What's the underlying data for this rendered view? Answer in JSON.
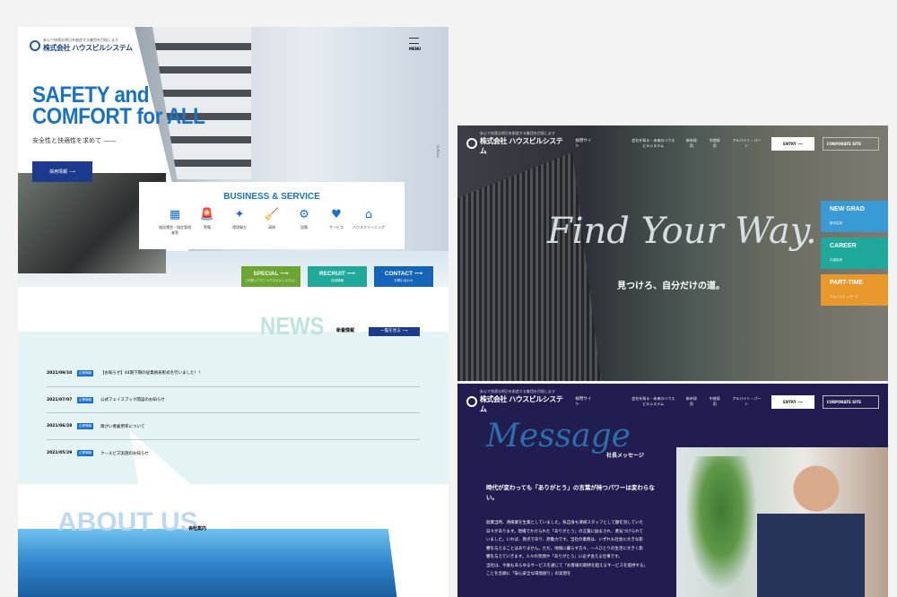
{
  "corporate_site": {
    "logo": {
      "tagline": "安心で快適な明日を創造する集団を目指します",
      "name": "株式会社 ハウスビルシステム"
    },
    "menu_label": "MENU",
    "hero": {
      "title_line1": "SAFETY and",
      "title_line2": "COMFORT for ALL",
      "subtitle": "安全性と快適性を求めて ——",
      "recruit_button": "採用情報 ⟶",
      "scroll_label": "SCROLL"
    },
    "business": {
      "title": "BUSINESS & SERVICE",
      "items": [
        {
          "icon": "building-icon",
          "glyph": "▦",
          "label": "施設運営・指定管理者等"
        },
        {
          "icon": "alarm-light-icon",
          "glyph": "🚨",
          "label": "警備"
        },
        {
          "icon": "sparkle-icon",
          "glyph": "✦",
          "label": "環境衛生"
        },
        {
          "icon": "broom-icon",
          "glyph": "🧹",
          "label": "清掃"
        },
        {
          "icon": "gear-icon",
          "glyph": "⚙",
          "label": "設備"
        },
        {
          "icon": "heart-hand-icon",
          "glyph": "♥",
          "label": "サービス"
        },
        {
          "icon": "house-icon",
          "glyph": "⌂",
          "label": "ハウスクリーニング"
        }
      ]
    },
    "cta": [
      {
        "title": "SPECIAL ⟶",
        "sub": "これ知ってた？ハウスビルシステム！",
        "color": "#6aa631"
      },
      {
        "title": "RECRUIT ⟶",
        "sub": "採用情報",
        "color": "#1ea99a"
      },
      {
        "title": "CONTACT ⟶",
        "sub": "お問い合わせ",
        "color": "#1464b8"
      }
    ],
    "news": {
      "title": "NEWS",
      "subtitle": "新着情報",
      "all_button": "一覧を見る ⟶",
      "items": [
        {
          "date": "2021/09/10",
          "category": "企業情報",
          "text": "【お知らせ】44期下期の従業員表彰式を行いました！！"
        },
        {
          "date": "2021/07/07",
          "category": "企業情報",
          "text": "公式フェイスブック開設のお知らせ"
        },
        {
          "date": "2021/06/28",
          "category": "企業情報",
          "text": "障がい者雇用率について"
        },
        {
          "date": "2021/05/29",
          "category": "企業情報",
          "text": "クールビズ実施のお知らせ"
        }
      ]
    },
    "about": {
      "title": "ABOUT US",
      "subtitle": "会社案内"
    }
  },
  "recruit_site": {
    "header": {
      "site_label": "採用サイト",
      "nav": [
        "会社を知る・未来のハウスビルシステム",
        "新卒採用",
        "中途採用",
        "アルバイト・パート"
      ],
      "entry": "ENTRY ⟶",
      "corporate": "CORPORATE SITE"
    },
    "hero": {
      "headline": "Find Your Way.",
      "sub": "見つけろ、自分だけの道。"
    },
    "side_buttons": [
      {
        "title": "NEW GRAD",
        "sub": "新卒採用",
        "color": "#3a9ad6"
      },
      {
        "title": "CAREER",
        "sub": "中途採用",
        "color": "#1ea99a"
      },
      {
        "title": "PART-TIME",
        "sub": "アルバイト・パート",
        "color": "#e9982c"
      }
    ],
    "message": {
      "title": "Message",
      "subtitle": "社長メッセージ",
      "lead": "時代が変わっても「ありがとう」の言葉が持つパワーは変わらない。",
      "body": "創業当時、清掃業を生業としていました。私自身も清掃スタッフとして額を流していた日々があります。現場でかけられた「ありがとう」の言葉に励まされ、勇気づけられていました。いわば、原点であり、原動力です。当社の業務は、いずれも社会に大きな影響を与えることはありません。ただ、地域に暮らす方々、一人ひとりの生活に大きく影響を与えていきます。人々の笑顔や「ありがとう」に必ず会える仕事です。\n当社は、今後もあらゆるサービスを通じて「お客様の期待を超えるサービスを提供する」ことを念頭に「安心安全な環境創り」の実現を"
    }
  }
}
